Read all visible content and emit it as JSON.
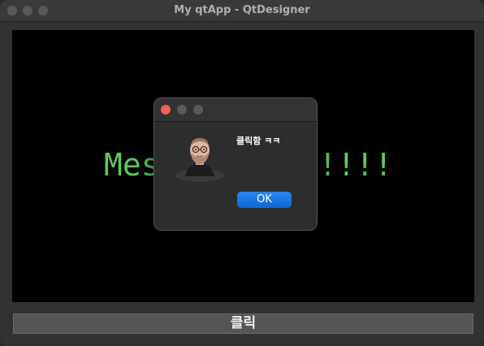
{
  "window": {
    "title": "My qtApp - QtDesigner"
  },
  "canvas": {
    "message_left": "Mes",
    "message_right": "!!!!"
  },
  "bottom_button": {
    "label": "클릭"
  },
  "dialog": {
    "message": "클릭함 ㅋㅋ",
    "ok_label": "OK"
  },
  "colors": {
    "message_text": "#5fc85f",
    "ok_button": "#1a73e8",
    "close_dot": "#ff5f57"
  },
  "icons": [
    "close-icon",
    "minimize-icon",
    "zoom-icon",
    "avatar-icon"
  ]
}
